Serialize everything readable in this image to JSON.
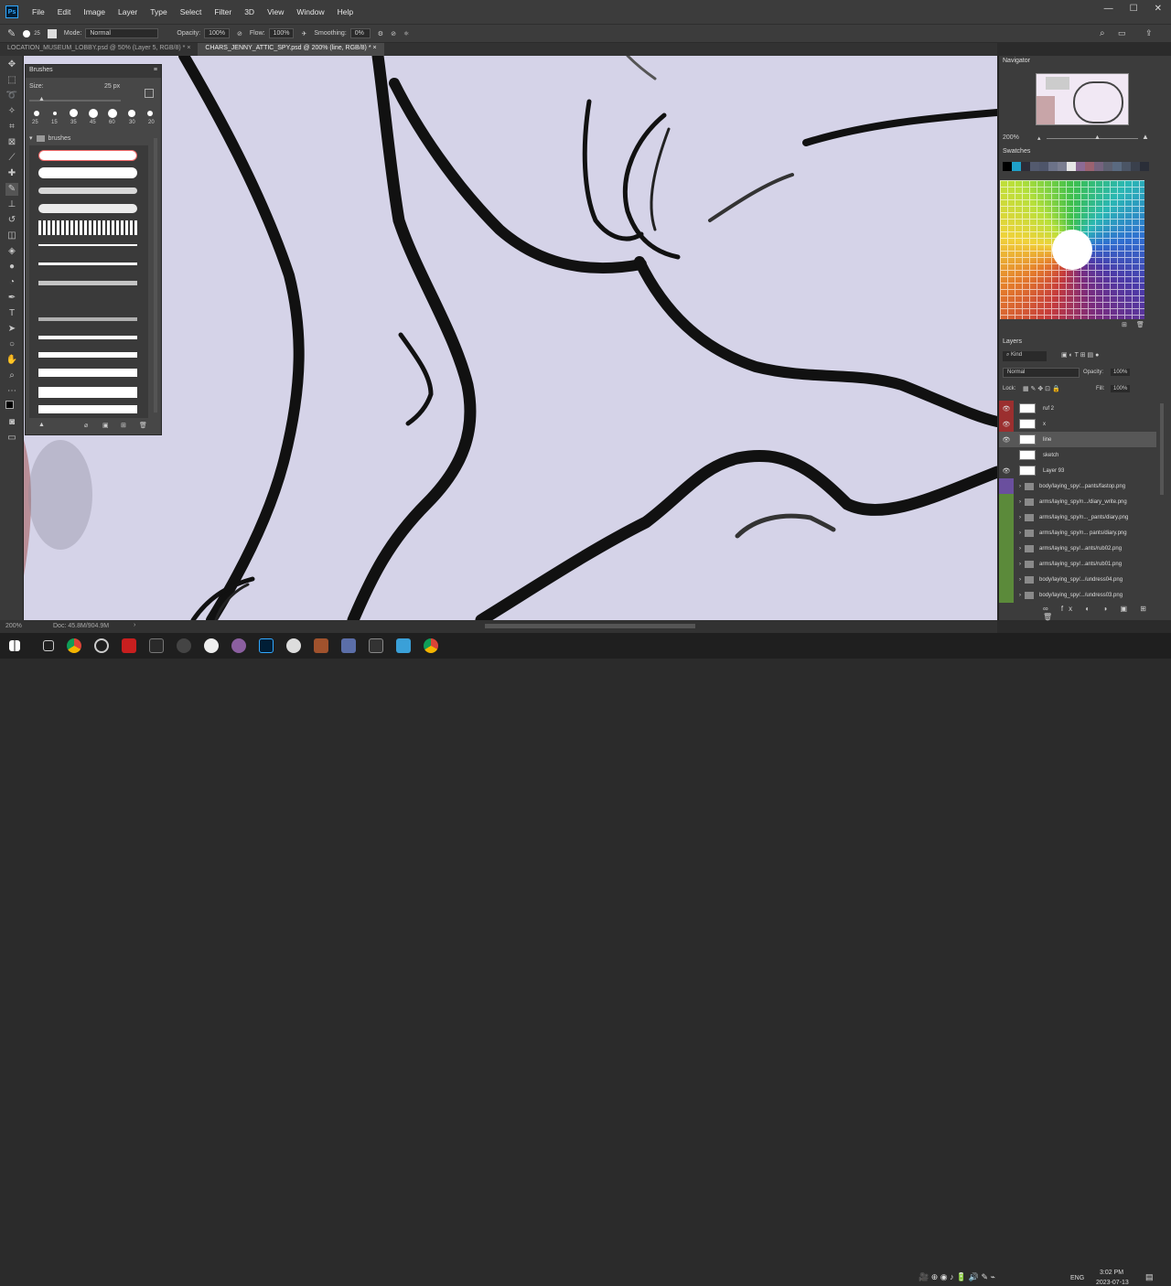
{
  "menubar": {
    "logo": "Ps",
    "items": [
      "File",
      "Edit",
      "Image",
      "Layer",
      "Type",
      "Select",
      "Filter",
      "3D",
      "View",
      "Window",
      "Help"
    ],
    "win_min": "—",
    "win_max": "☐",
    "win_close": "✕"
  },
  "options": {
    "brush_size": "25",
    "mode_label": "Mode:",
    "mode_value": "Normal",
    "opacity_label": "Opacity:",
    "opacity_value": "100%",
    "flow_label": "Flow:",
    "flow_value": "100%",
    "smoothing_label": "Smoothing:",
    "smoothing_value": "0%"
  },
  "tabs": [
    "LOCATION_MUSEUM_LOBBY.psd @ 50% (Layer 5, RGB/8) *",
    "CHARS_JENNY_ATTIC_SPY.psd @ 200% (line, RGB/8) *"
  ],
  "brushes_panel": {
    "title": "Brushes",
    "size_label": "Size:",
    "size_value": "25 px",
    "tip_sizes": [
      "25",
      "15",
      "35",
      "45",
      "60",
      "30",
      "20"
    ],
    "folder_label": "brushes"
  },
  "navigator": {
    "title": "Navigator",
    "zoom": "200%"
  },
  "swatches": {
    "title": "Swatches"
  },
  "layers": {
    "title": "Layers",
    "filter_label": "Kind",
    "blend_mode": "Normal",
    "opacity_label": "Opacity:",
    "opacity_value": "100%",
    "lock_label": "Lock:",
    "fill_label": "Fill:",
    "fill_value": "100%",
    "rows": [
      {
        "name": "ruf 2",
        "vis": "👁",
        "color": "#9b2f2f",
        "type": "layer"
      },
      {
        "name": "x",
        "vis": "👁",
        "color": "#9b2f2f",
        "type": "layer"
      },
      {
        "name": "line",
        "vis": "👁",
        "color": "",
        "type": "layer",
        "selected": true
      },
      {
        "name": "sketch",
        "vis": "",
        "color": "",
        "type": "layer"
      },
      {
        "name": "Layer 93",
        "vis": "👁",
        "color": "",
        "type": "layer"
      },
      {
        "name": "body/laying_spy/...pants/fastop.png",
        "vis": "",
        "color": "#6a4f9e",
        "type": "folder"
      },
      {
        "name": "arms/laying_spy/n.../diary_write.png",
        "vis": "",
        "color": "#5b8a3a",
        "type": "folder"
      },
      {
        "name": "arms/laying_spy/n..._pants/diary.png",
        "vis": "",
        "color": "#5b8a3a",
        "type": "folder"
      },
      {
        "name": "arms/laying_spy/n... pants/diary.png",
        "vis": "",
        "color": "#5b8a3a",
        "type": "folder"
      },
      {
        "name": "arms/laying_spy/...ants/rub02.png",
        "vis": "",
        "color": "#5b8a3a",
        "type": "folder"
      },
      {
        "name": "arms/laying_spy/...ants/rub01.png",
        "vis": "",
        "color": "#5b8a3a",
        "type": "folder"
      },
      {
        "name": "body/laying_spy/.../undress04.png",
        "vis": "",
        "color": "#5b8a3a",
        "type": "folder"
      },
      {
        "name": "body/laying_spy/.../undress03.png",
        "vis": "",
        "color": "#5b8a3a",
        "type": "folder"
      }
    ]
  },
  "status": {
    "zoom": "200%",
    "doc": "Doc: 45.8M/904.9M"
  },
  "taskbar": {
    "lang": "ENG",
    "time": "3:02 PM",
    "date": "2023-07-13"
  }
}
